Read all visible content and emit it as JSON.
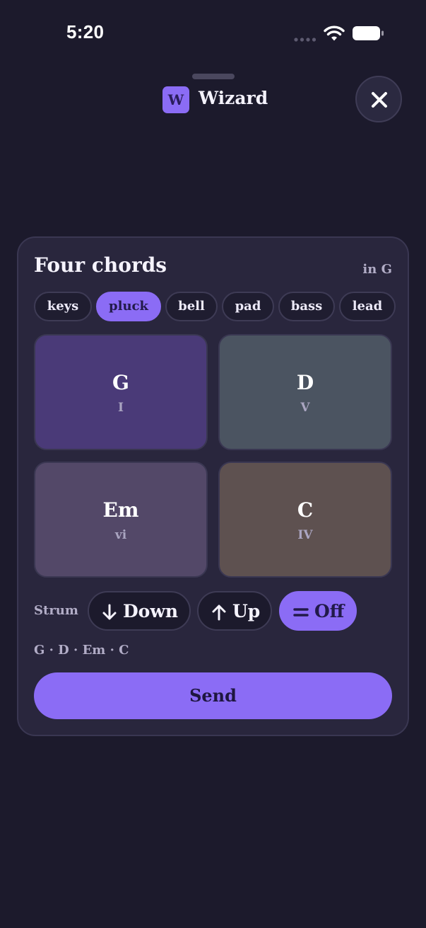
{
  "status_bar": {
    "time": "5:20"
  },
  "header": {
    "logo_letter": "W",
    "title": "Wizard"
  },
  "card": {
    "title": "Four chords",
    "key": "in G",
    "instruments": [
      {
        "label": "keys",
        "active": false
      },
      {
        "label": "pluck",
        "active": true
      },
      {
        "label": "bell",
        "active": false
      },
      {
        "label": "pad",
        "active": false
      },
      {
        "label": "bass",
        "active": false
      },
      {
        "label": "lead",
        "active": false
      }
    ],
    "pads": [
      {
        "chord": "G",
        "numeral": "I",
        "color": "#4a3a78"
      },
      {
        "chord": "D",
        "numeral": "V",
        "color": "#4b5461"
      },
      {
        "chord": "Em",
        "numeral": "vi",
        "color": "#534868"
      },
      {
        "chord": "C",
        "numeral": "IV",
        "color": "#5e5150"
      }
    ],
    "strum": {
      "label": "Strum",
      "options": [
        {
          "label": "Down",
          "icon": "arrow-down-icon",
          "active": false
        },
        {
          "label": "Up",
          "icon": "arrow-up-icon",
          "active": false
        },
        {
          "label": "Off",
          "icon": "equals-icon",
          "active": true
        }
      ]
    },
    "progression": "G · D · Em · C",
    "send_label": "Send"
  },
  "colors": {
    "accent": "#8b6cf5",
    "background": "#1c1a2c",
    "card": "#29263d"
  }
}
